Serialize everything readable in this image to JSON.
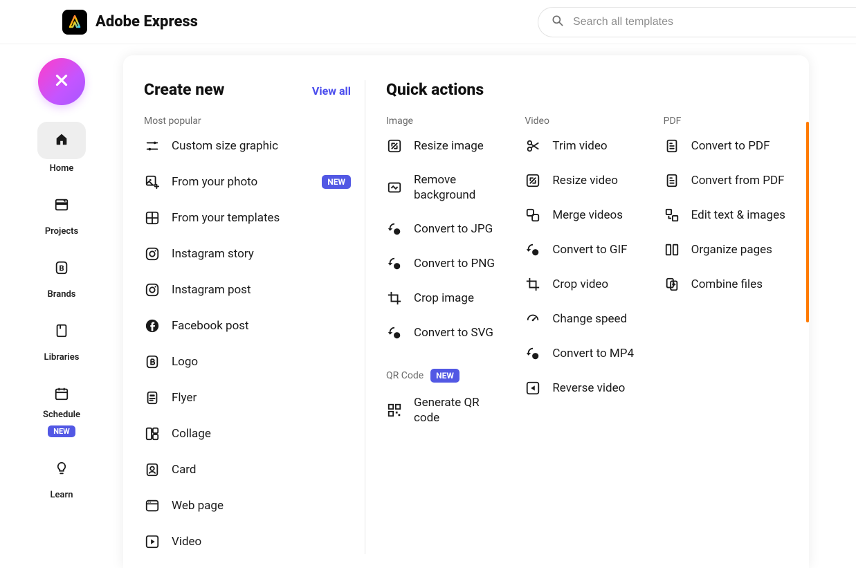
{
  "brand": {
    "title": "Adobe Express"
  },
  "search": {
    "placeholder": "Search all templates"
  },
  "sidebar": {
    "items": [
      {
        "label": "Home"
      },
      {
        "label": "Projects"
      },
      {
        "label": "Brands"
      },
      {
        "label": "Libraries"
      },
      {
        "label": "Schedule",
        "badge": "NEW"
      },
      {
        "label": "Learn"
      }
    ]
  },
  "panel": {
    "create": {
      "title": "Create new",
      "view_all": "View all",
      "section_label": "Most popular",
      "items": [
        {
          "label": "Custom size graphic"
        },
        {
          "label": "From your photo",
          "badge": "NEW"
        },
        {
          "label": "From your templates"
        },
        {
          "label": "Instagram story"
        },
        {
          "label": "Instagram post"
        },
        {
          "label": "Facebook post"
        },
        {
          "label": "Logo"
        },
        {
          "label": "Flyer"
        },
        {
          "label": "Collage"
        },
        {
          "label": "Card"
        },
        {
          "label": "Web page"
        },
        {
          "label": "Video"
        }
      ]
    },
    "quick": {
      "title": "Quick actions",
      "image": {
        "label": "Image",
        "items": [
          {
            "label": "Resize image"
          },
          {
            "label": "Remove background"
          },
          {
            "label": "Convert to JPG"
          },
          {
            "label": "Convert to PNG"
          },
          {
            "label": "Crop image"
          },
          {
            "label": "Convert to SVG"
          }
        ]
      },
      "qr": {
        "label": "QR Code",
        "badge": "NEW",
        "items": [
          {
            "label": "Generate QR code"
          }
        ]
      },
      "video": {
        "label": "Video",
        "items": [
          {
            "label": "Trim video"
          },
          {
            "label": "Resize video"
          },
          {
            "label": "Merge videos"
          },
          {
            "label": "Convert to GIF"
          },
          {
            "label": "Crop video"
          },
          {
            "label": "Change speed"
          },
          {
            "label": "Convert to MP4"
          },
          {
            "label": "Reverse video"
          }
        ]
      },
      "pdf": {
        "label": "PDF",
        "items": [
          {
            "label": "Convert to PDF"
          },
          {
            "label": "Convert from PDF"
          },
          {
            "label": "Edit text & images"
          },
          {
            "label": "Organize pages"
          },
          {
            "label": "Combine files"
          }
        ]
      }
    }
  }
}
